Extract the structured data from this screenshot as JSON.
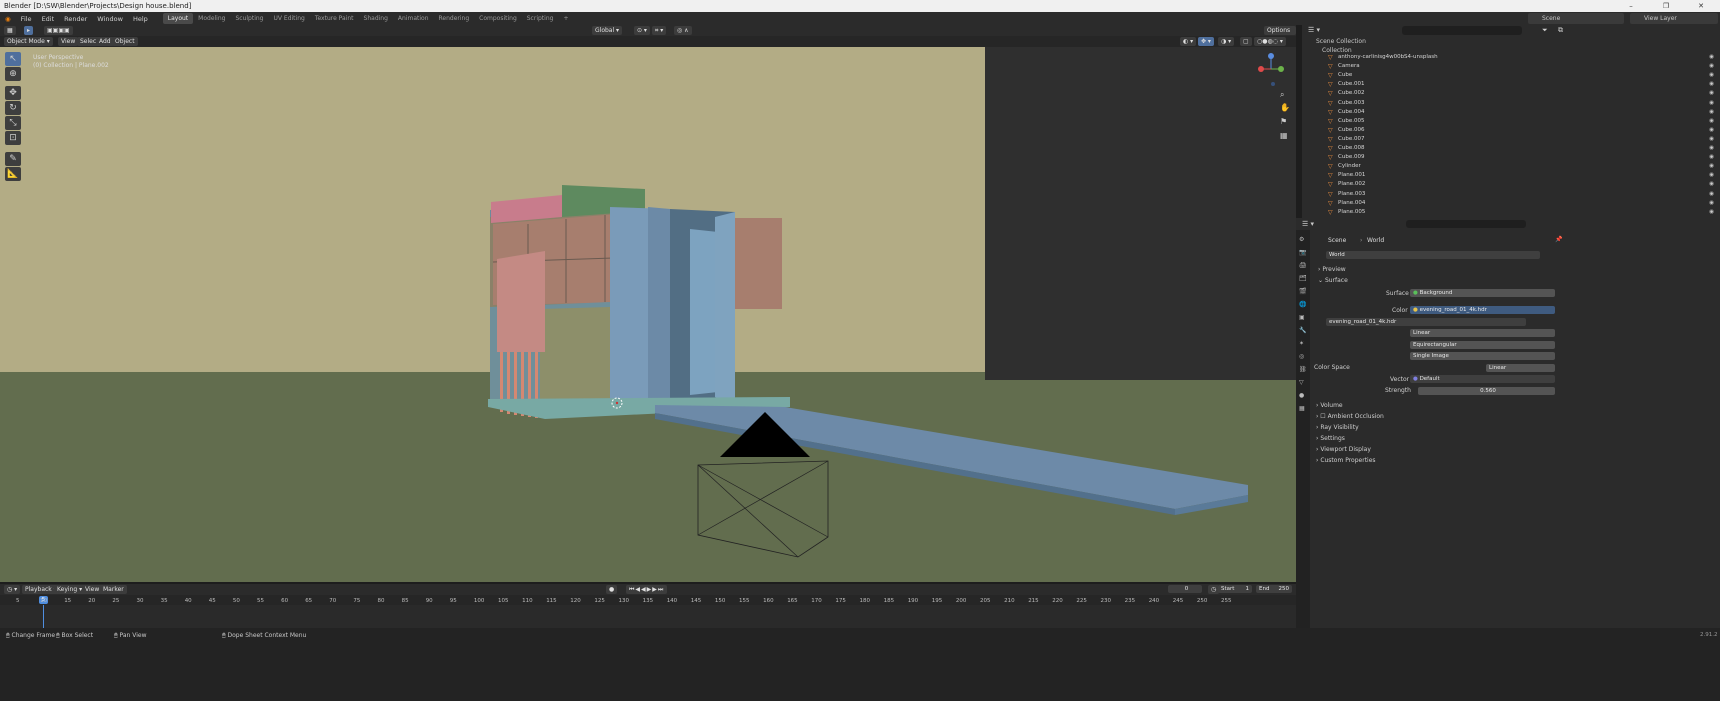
{
  "window": {
    "title": "Blender [D:\\SW\\Blender\\Projects\\Design house.blend]",
    "controls": [
      "–",
      "❐",
      "✕"
    ]
  },
  "menu": {
    "items": [
      "File",
      "Edit",
      "Render",
      "Window",
      "Help"
    ],
    "workspaces": [
      "Layout",
      "Modeling",
      "Sculpting",
      "UV Editing",
      "Texture Paint",
      "Shading",
      "Animation",
      "Rendering",
      "Compositing",
      "Scripting"
    ],
    "active_workspace": "Layout",
    "add_tab": "+",
    "scene": "Scene",
    "view_layer": "View Layer"
  },
  "viewport_header": {
    "mode": "Object Mode",
    "menus": [
      "View",
      "Select",
      "Add",
      "Object"
    ],
    "orientation": "Global",
    "options": "Options"
  },
  "viewport": {
    "perspective": "User Perspective",
    "context": "(0) Collection | Plane.002"
  },
  "outliner": {
    "title": "Scene Collection",
    "collection": "Collection",
    "items": [
      {
        "name": "anthony-carlinisg4w00bS4-unsplash"
      },
      {
        "name": "Camera"
      },
      {
        "name": "Cube"
      },
      {
        "name": "Cube.001"
      },
      {
        "name": "Cube.002"
      },
      {
        "name": "Cube.003"
      },
      {
        "name": "Cube.004"
      },
      {
        "name": "Cube.005"
      },
      {
        "name": "Cube.006"
      },
      {
        "name": "Cube.007"
      },
      {
        "name": "Cube.008"
      },
      {
        "name": "Cube.009"
      },
      {
        "name": "Cylinder"
      },
      {
        "name": "Plane.001"
      },
      {
        "name": "Plane.002"
      },
      {
        "name": "Plane.003"
      },
      {
        "name": "Plane.004"
      },
      {
        "name": "Plane.005"
      }
    ]
  },
  "properties": {
    "breadcrumb_scene": "Scene",
    "breadcrumb_world": "World",
    "datablock": "World",
    "panels": {
      "preview": "Preview",
      "surface": "Surface",
      "volume": "Volume",
      "ambient_occlusion": "Ambient Occlusion",
      "ray_visibility": "Ray Visibility",
      "settings": "Settings",
      "viewport_display": "Viewport Display",
      "custom_properties": "Custom Properties"
    },
    "surface_label": "Surface",
    "surface_value": "Background",
    "color_label": "Color",
    "color_value": "evening_road_01_4k.hdr",
    "image_name": "evening_road_01_4k.hdr",
    "interpolation": "Linear",
    "projection": "Equirectangular",
    "source": "Single Image",
    "color_space_label": "Color Space",
    "color_space_value": "Linear",
    "vector_label": "Vector",
    "vector_value": "Default",
    "strength_label": "Strength",
    "strength_value": "0.560"
  },
  "timeline": {
    "menus": [
      "Playback",
      "Keying",
      "View",
      "Marker"
    ],
    "current_frame": "0",
    "start_label": "Start",
    "start_value": "1",
    "end_label": "End",
    "end_value": "250",
    "ruler_ticks": [
      "5",
      "10",
      "15",
      "20",
      "25",
      "30",
      "35",
      "40",
      "45",
      "50",
      "55",
      "60",
      "65",
      "70",
      "75",
      "80",
      "85",
      "90",
      "95",
      "100",
      "105",
      "110",
      "115",
      "120",
      "125",
      "130",
      "135",
      "140",
      "145",
      "150",
      "155",
      "160",
      "165",
      "170",
      "175",
      "180",
      "185",
      "190",
      "195",
      "200",
      "205",
      "210",
      "215",
      "220",
      "225",
      "230",
      "235",
      "240",
      "245",
      "250",
      "255"
    ],
    "playhead_label": "5"
  },
  "statusbar": {
    "items": [
      "Change Frame",
      "Box Select",
      "Pan View",
      "Dope Sheet Context Menu"
    ],
    "version": "2.91.2"
  }
}
